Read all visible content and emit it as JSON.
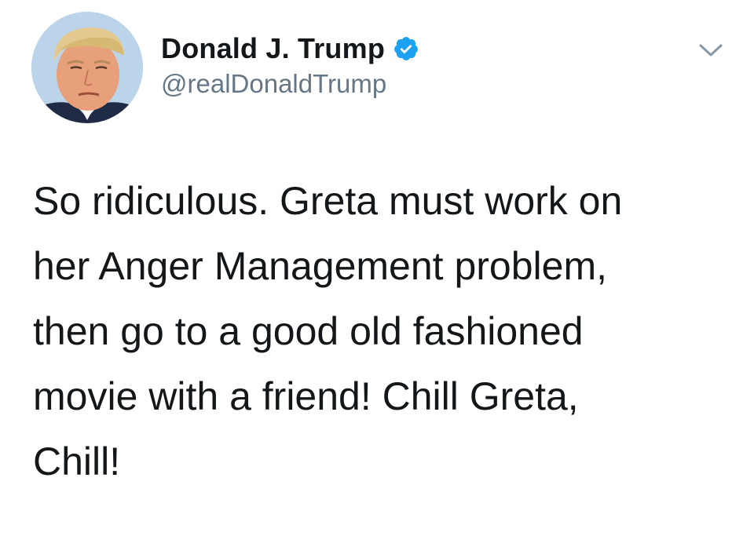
{
  "tweet": {
    "author": {
      "display_name": "Donald J. Trump",
      "handle": "@realDonaldTrump",
      "verified": true,
      "avatar_icon": "profile-photo",
      "verified_icon": "verified-badge-icon"
    },
    "menu_icon": "chevron-down-icon",
    "text": "So ridiculous. Greta must work on\nher Anger Management problem,\nthen go to a good old fashioned\nmovie with a friend! Chill Greta,\nChill!"
  },
  "colors": {
    "background": "#ffffff",
    "text": "#14171a",
    "secondary_text": "#657786",
    "verified_blue": "#1da1f2",
    "chevron": "#8899a6"
  }
}
